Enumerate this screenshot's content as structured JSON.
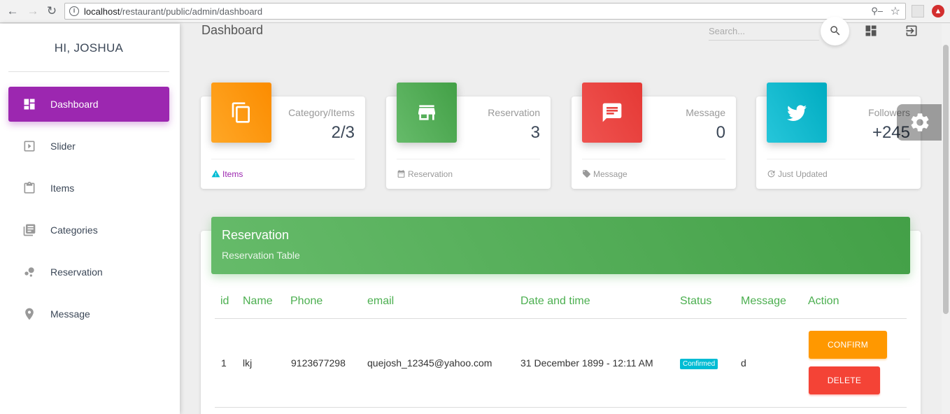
{
  "browser": {
    "url_host": "localhost",
    "url_path": "/restaurant/public/admin/dashboard"
  },
  "sidebar": {
    "user_name": "HI, JOSHUA",
    "items": [
      {
        "label": "Dashboard",
        "icon": "dashboard-icon",
        "active": true
      },
      {
        "label": "Slider",
        "icon": "slideshow-icon",
        "active": false
      },
      {
        "label": "Items",
        "icon": "clipboard-icon",
        "active": false
      },
      {
        "label": "Categories",
        "icon": "library-books-icon",
        "active": false
      },
      {
        "label": "Reservation",
        "icon": "bubble-chart-icon",
        "active": false
      },
      {
        "label": "Message",
        "icon": "location-pin-icon",
        "active": false
      }
    ],
    "active_color": "#9c27b0"
  },
  "header": {
    "title": "Dashboard",
    "search_placeholder": "Search..."
  },
  "cards": [
    {
      "category": "Category/Items",
      "value": "2/3",
      "footer": "Items",
      "icon": "copy-icon",
      "footer_icon": "warning-icon",
      "color": "#fb8c00"
    },
    {
      "category": "Reservation",
      "value": "3",
      "footer": "Reservation",
      "icon": "store-icon",
      "footer_icon": "calendar-icon",
      "color": "#43a047"
    },
    {
      "category": "Message",
      "value": "0",
      "footer": "Message",
      "icon": "chat-icon",
      "footer_icon": "tag-icon",
      "color": "#e53935"
    },
    {
      "category": "Followers",
      "value": "+245",
      "footer": "Just Updated",
      "icon": "twitter-icon",
      "footer_icon": "update-icon",
      "color": "#00acc1"
    }
  ],
  "table": {
    "title": "Reservation",
    "subtitle": "Reservation Table",
    "columns": [
      "id",
      "Name",
      "Phone",
      "email",
      "Date and time",
      "Status",
      "Message",
      "Action"
    ],
    "rows": [
      {
        "id": "1",
        "name": "lkj",
        "phone": "9123677298",
        "email": "quejosh_12345@yahoo.com",
        "datetime": "31 December 1899 - 12:11 AM",
        "status": "Confirmed",
        "message": "d",
        "actions": {
          "confirm": "CONFIRM",
          "delete": "DELETE"
        }
      }
    ]
  }
}
